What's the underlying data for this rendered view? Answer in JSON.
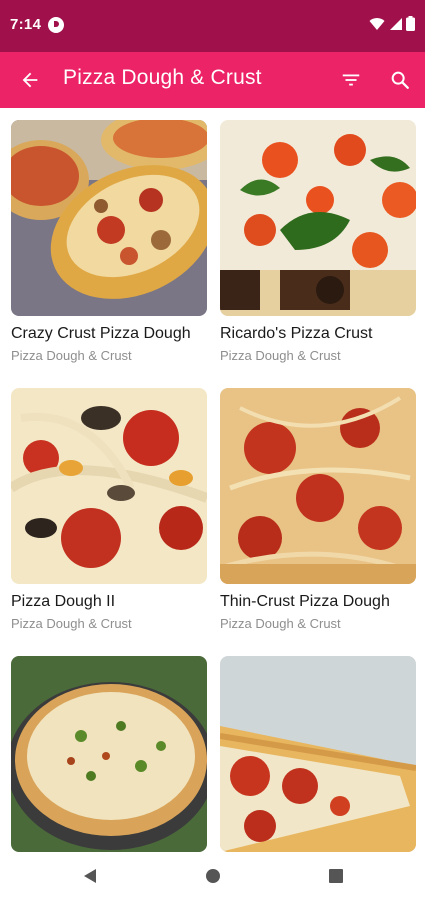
{
  "status_bar": {
    "time": "7:14",
    "icons": [
      "app-notification-icon",
      "wifi-icon",
      "cellular-signal-icon",
      "battery-icon"
    ]
  },
  "app_bar": {
    "title": "Pizza Dough & Crust",
    "icons": [
      "back-arrow-icon",
      "filter-icon",
      "search-icon"
    ],
    "background_color": "#ec2366",
    "status_color": "#a0104a"
  },
  "recipes": [
    {
      "title": "Crazy Crust Pizza Dough",
      "category": "Pizza Dough & Crust"
    },
    {
      "title": "Ricardo's Pizza Crust",
      "category": "Pizza Dough & Crust"
    },
    {
      "title": "Pizza Dough II",
      "category": "Pizza Dough & Crust"
    },
    {
      "title": "Thin-Crust Pizza Dough",
      "category": "Pizza Dough & Crust"
    },
    {
      "title": "",
      "category": ""
    },
    {
      "title": "",
      "category": ""
    }
  ],
  "nav_bar": {
    "icons": [
      "nav-back-icon",
      "nav-home-icon",
      "nav-recents-icon"
    ]
  }
}
